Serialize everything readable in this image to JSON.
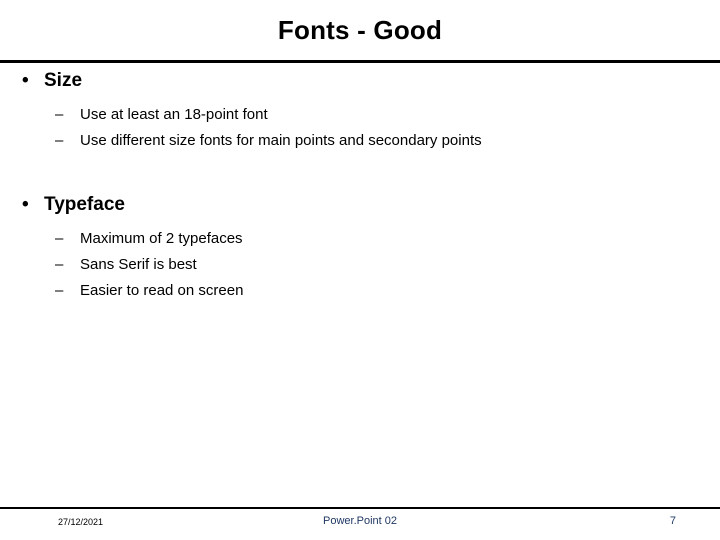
{
  "slide": {
    "title": "Fonts - Good",
    "groups": [
      {
        "heading": "Size",
        "heading_bullet": "•",
        "sub_bullet": "–",
        "items": [
          "Use at least an 18-point font",
          "Use different size fonts for main points and secondary points"
        ]
      },
      {
        "heading": "Typeface",
        "heading_bullet": "•",
        "sub_bullet": "–",
        "items": [
          "Maximum of 2 typefaces",
          "Sans Serif is best",
          "Easier to read on screen"
        ]
      }
    ],
    "footer": {
      "date": "27/12/2021",
      "center": "Power.Point 02",
      "page": "7"
    },
    "colors": {
      "text": "#000000",
      "footer_accent": "#1f3864",
      "rule": "#000000"
    }
  }
}
